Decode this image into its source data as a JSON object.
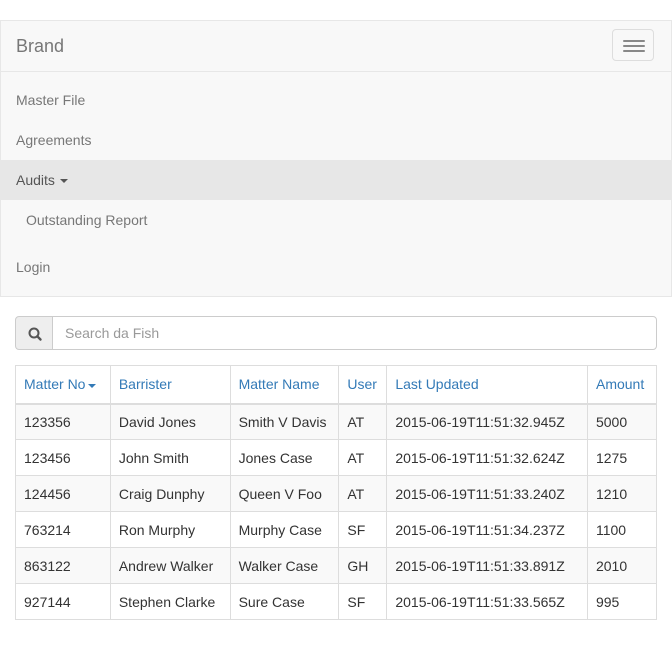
{
  "navbar": {
    "brand": "Brand",
    "items": [
      {
        "label": "Master File"
      },
      {
        "label": "Agreements"
      },
      {
        "label": "Audits"
      },
      {
        "label": "Login"
      }
    ],
    "audits_submenu": [
      {
        "label": "Outstanding Report"
      }
    ]
  },
  "search": {
    "placeholder": "Search da Fish",
    "value": ""
  },
  "table": {
    "sort_column": "Matter No",
    "sort_direction": "descending",
    "headers": [
      "Matter No",
      "Barrister",
      "Matter Name",
      "User",
      "Last Updated",
      "Amount"
    ],
    "rows": [
      [
        "123356",
        "David Jones",
        "Smith V Davis",
        "AT",
        "2015-06-19T11:51:32.945Z",
        "5000"
      ],
      [
        "123456",
        "John Smith",
        "Jones Case",
        "AT",
        "2015-06-19T11:51:32.624Z",
        "1275"
      ],
      [
        "124456",
        "Craig Dunphy",
        "Queen V Foo",
        "AT",
        "2015-06-19T11:51:33.240Z",
        "1210"
      ],
      [
        "763214",
        "Ron Murphy",
        "Murphy Case",
        "SF",
        "2015-06-19T11:51:34.237Z",
        "1100"
      ],
      [
        "863122",
        "Andrew Walker",
        "Walker Case",
        "GH",
        "2015-06-19T11:51:33.891Z",
        "2010"
      ],
      [
        "927144",
        "Stephen Clarke",
        "Sure Case",
        "SF",
        "2015-06-19T11:51:33.565Z",
        "995"
      ]
    ]
  },
  "colors": {
    "link": "#337ab7",
    "navbar_bg": "#f8f8f8",
    "active_item_bg": "#e7e7e7",
    "stripe_bg": "#f9f9f9"
  }
}
